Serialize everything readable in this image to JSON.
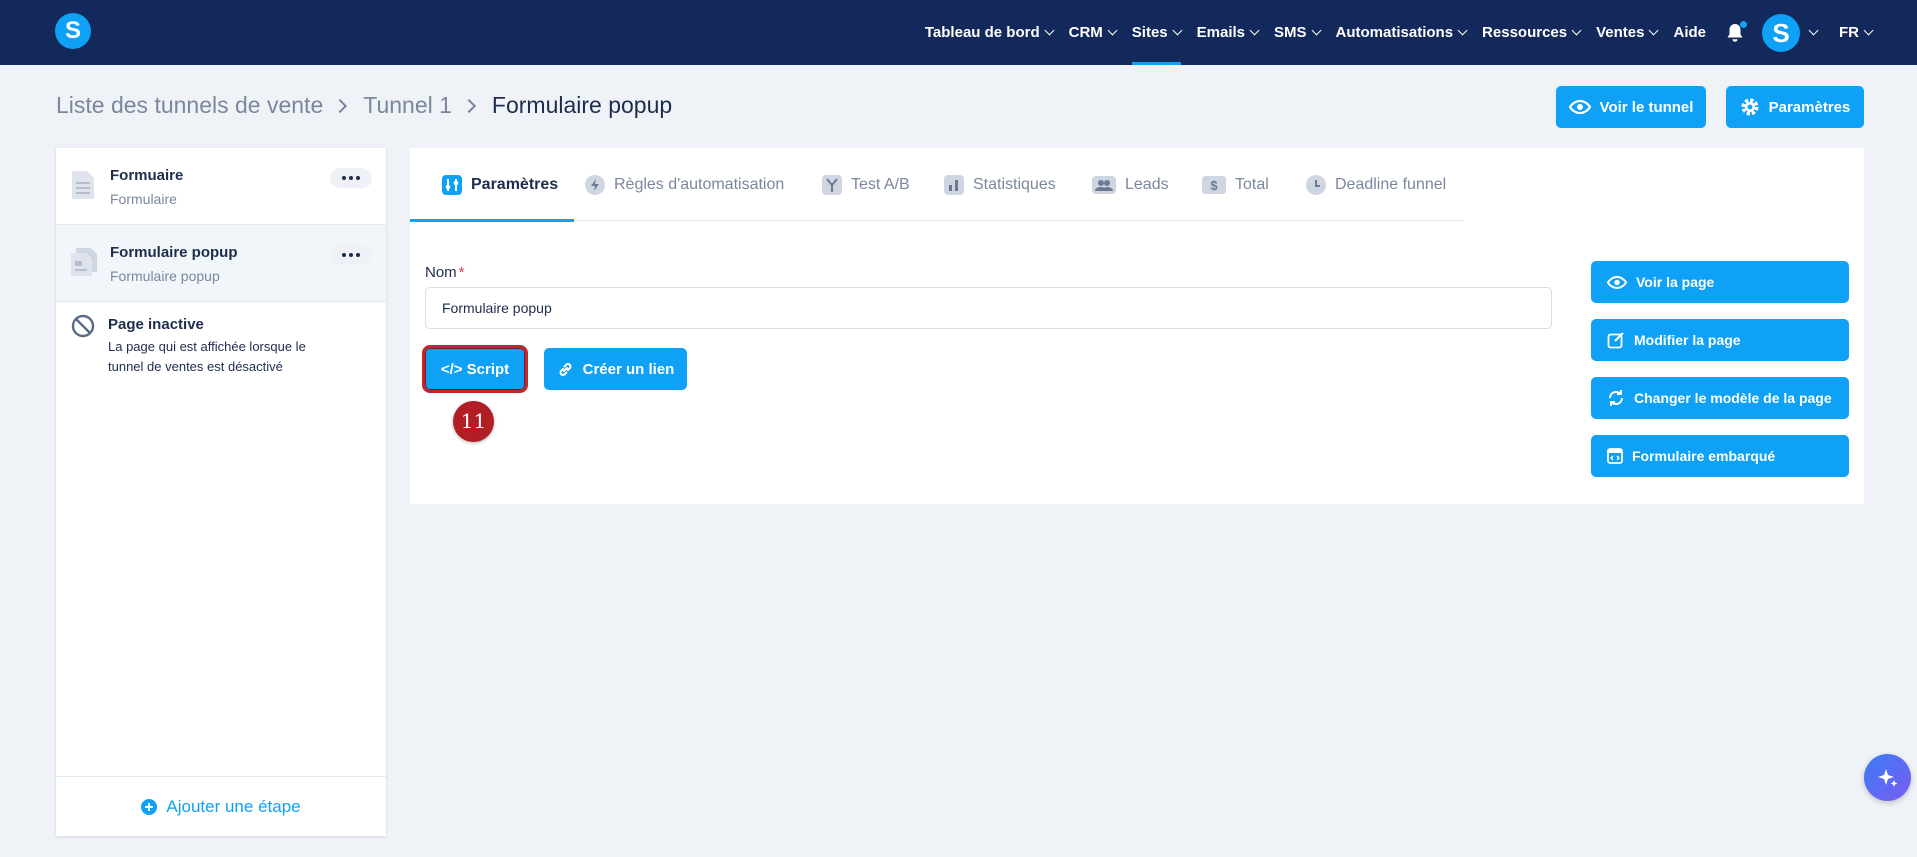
{
  "nav": {
    "items": [
      {
        "label": "Tableau de bord"
      },
      {
        "label": "CRM"
      },
      {
        "label": "Sites"
      },
      {
        "label": "Emails"
      },
      {
        "label": "SMS"
      },
      {
        "label": "Automatisations"
      },
      {
        "label": "Ressources"
      },
      {
        "label": "Ventes"
      }
    ],
    "aide": "Aide",
    "logo_letter": "S",
    "avatar_letter": "S",
    "language": "FR",
    "active_item": "Sites"
  },
  "breadcrumb": {
    "items": [
      "Liste des tunnels de vente",
      "Tunnel 1"
    ],
    "current": "Formulaire popup"
  },
  "header_buttons": {
    "view_funnel": "Voir le tunnel",
    "settings": "Paramètres"
  },
  "sidebar": {
    "steps": [
      {
        "title": "Formuaire",
        "subtitle": "Formulaire"
      },
      {
        "title": "Formulaire popup",
        "subtitle": "Formulaire popup"
      }
    ],
    "inactive": {
      "title": "Page inactive",
      "desc_line1": "La page qui est affichée lorsque le",
      "desc_line2": "tunnel de ventes est désactivé"
    },
    "add_step": "Ajouter une étape"
  },
  "tabs": [
    {
      "label": "Paramètres",
      "icon": "sliders-icon"
    },
    {
      "label": "Règles d'automatisation",
      "icon": "bolt-icon"
    },
    {
      "label": "Test A/B",
      "icon": "split-icon"
    },
    {
      "label": "Statistiques",
      "icon": "bar-chart-icon"
    },
    {
      "label": "Leads",
      "icon": "users-icon"
    },
    {
      "label": "Total",
      "icon": "dollar-icon"
    },
    {
      "label": "Deadline funnel",
      "icon": "clock-icon"
    }
  ],
  "form": {
    "nom_label": "Nom",
    "required_mark": "*",
    "nom_value": "Formulaire popup",
    "script_button": "</> Script",
    "link_button": "Créer un lien"
  },
  "actions": {
    "view_page": "Voir la page",
    "edit_page": "Modifier la page",
    "change_template": "Changer le modèle de la page",
    "embedded_form": "Formulaire embarqué"
  },
  "annotation": {
    "step_number": "11"
  },
  "colors": {
    "primary": "#0ea1f5",
    "nav_bg": "#13295b",
    "page_bg": "#eff3f8",
    "annotation_red": "#b11e23"
  }
}
